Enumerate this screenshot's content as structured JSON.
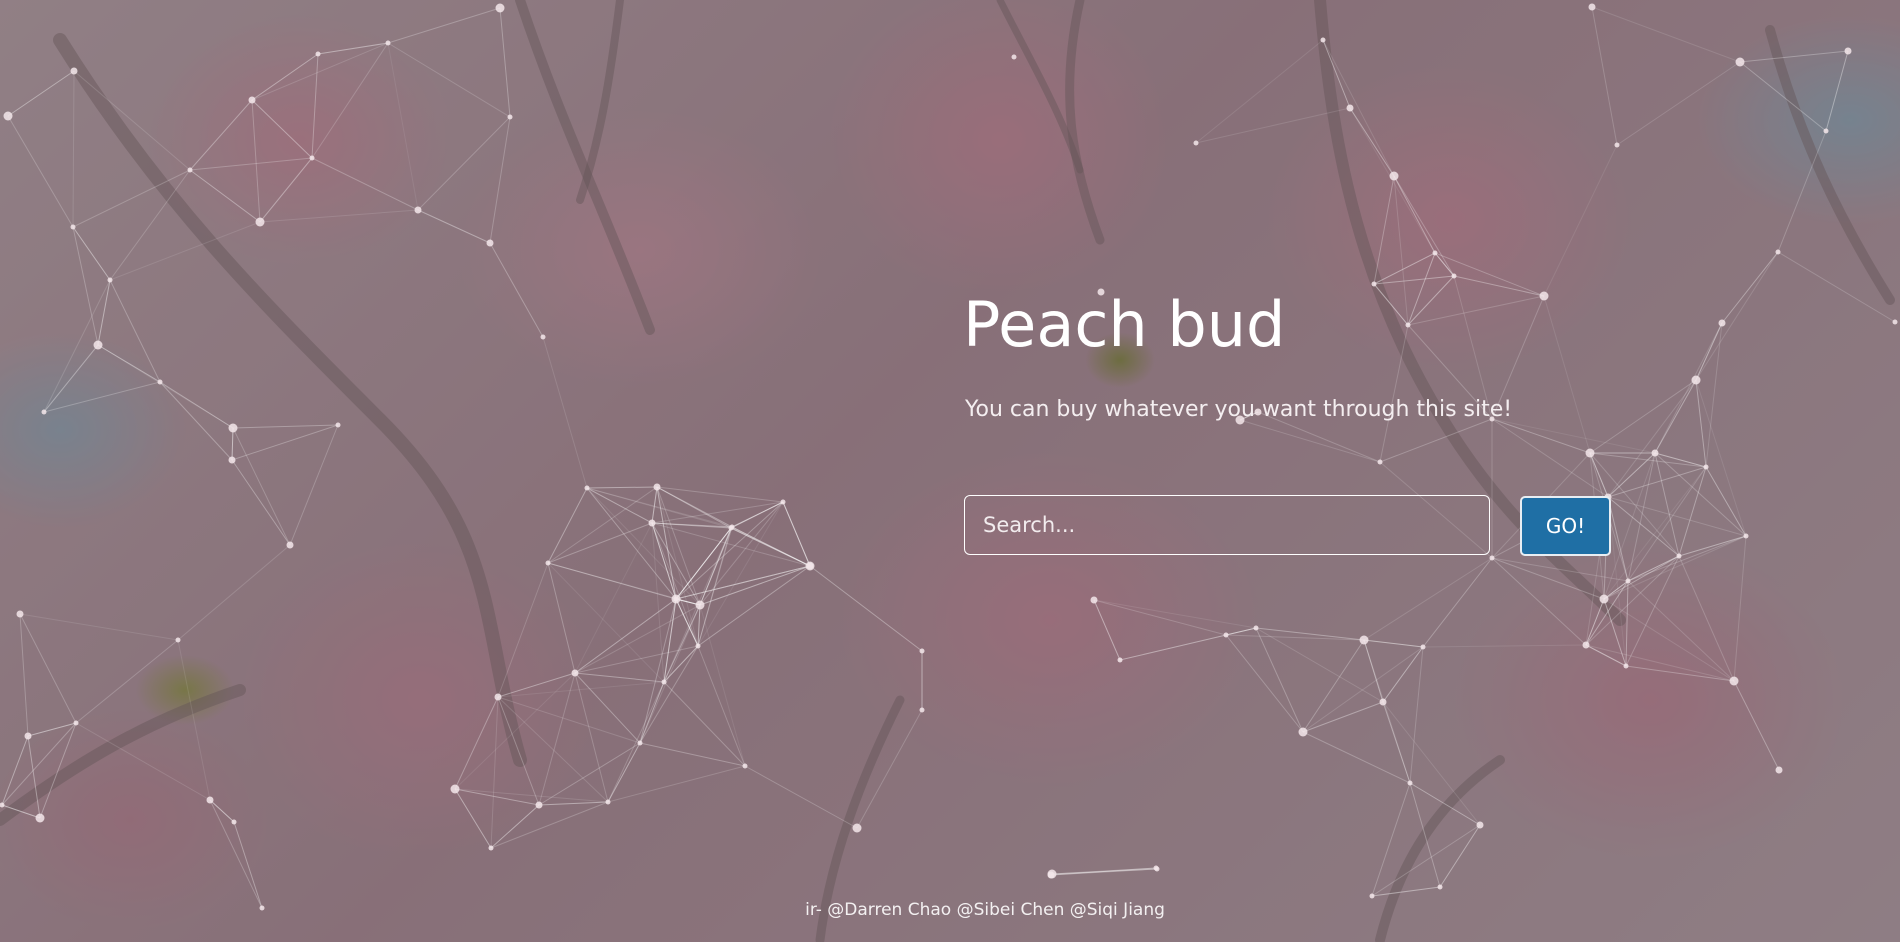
{
  "hero": {
    "title": "Peach bud",
    "subtitle": "You can buy whatever you want through this site!"
  },
  "search": {
    "placeholder": "Search...",
    "value": "",
    "button_label": "GO!"
  },
  "footer": {
    "credits": "ir- @Darren Chao @Sibei Chen @Siqi Jiang"
  },
  "colors": {
    "button_background": "#1f6fa5",
    "text": "#ffffff",
    "overlay": "rgba(90,90,90,0.42)",
    "network_lines": "rgba(255,255,255,0.45)"
  }
}
